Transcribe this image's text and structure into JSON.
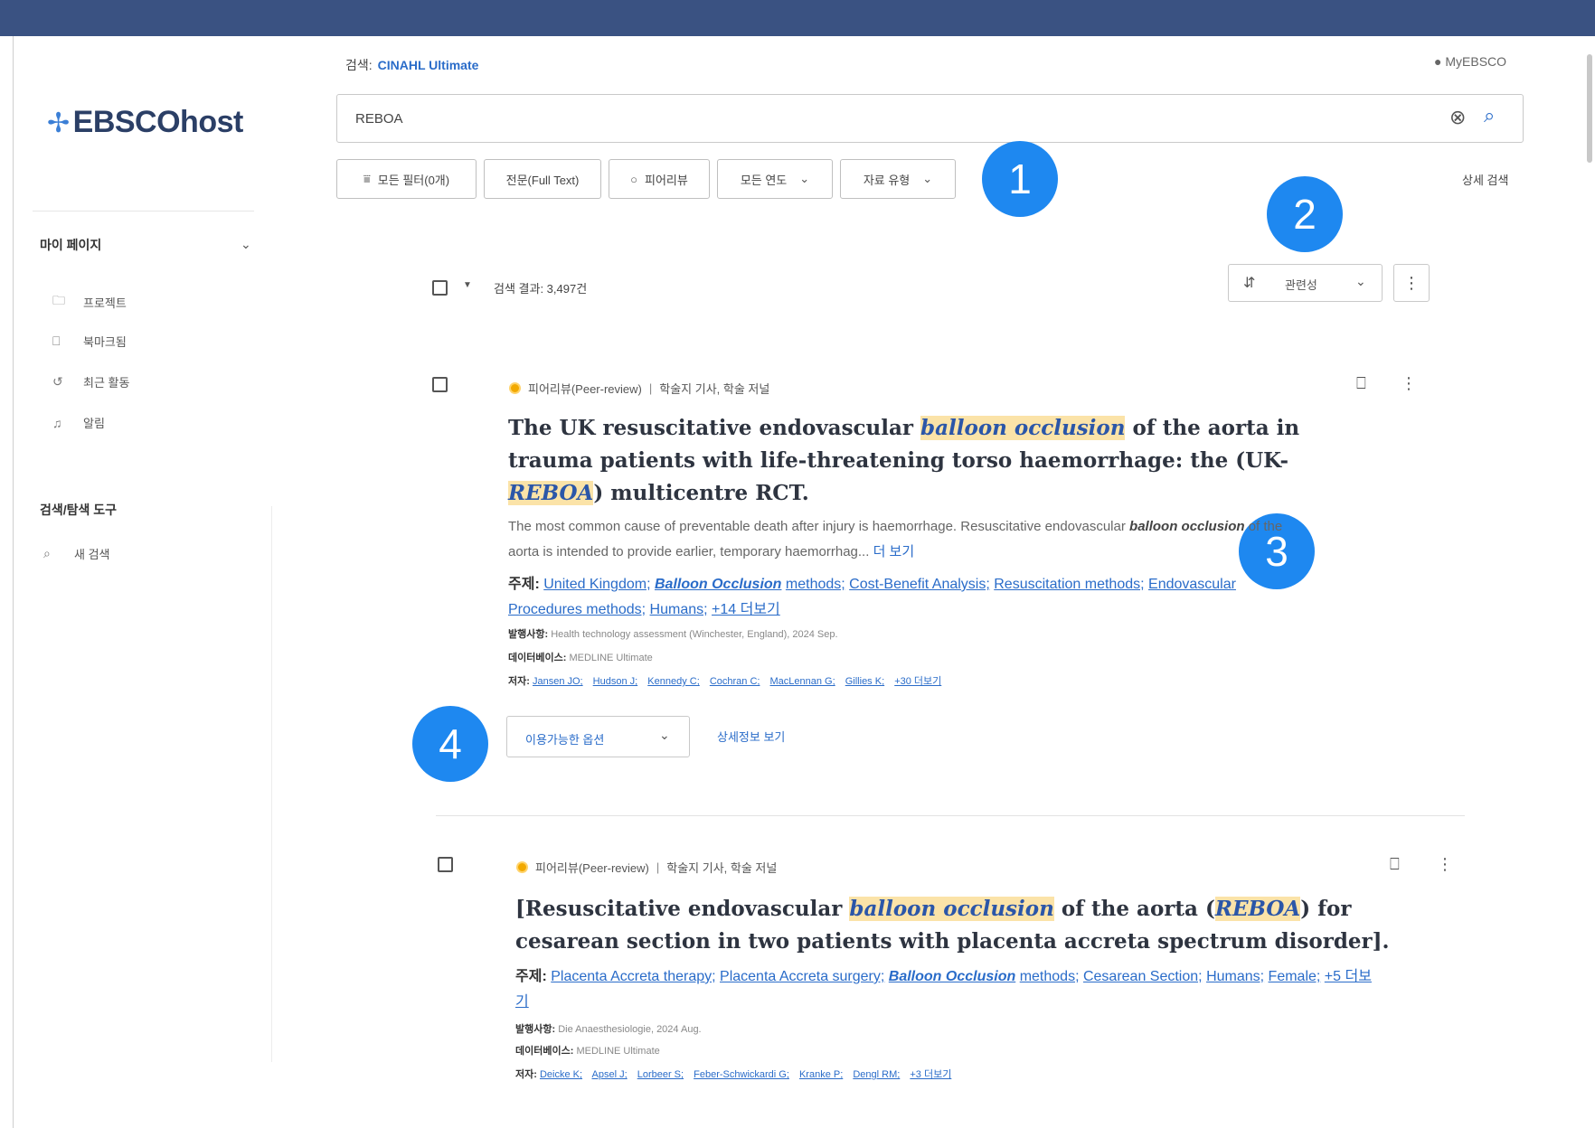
{
  "header": {
    "search_in_label": "검색:",
    "database": "CINAHL Ultimate",
    "account_label": "MyEBSCO"
  },
  "logo": {
    "text": "EBSCOhost"
  },
  "search": {
    "query": "REBOA"
  },
  "filters": {
    "all_filters": "모든 필터(0개)",
    "full_text": "전문(Full Text)",
    "peer_review": "피어리뷰",
    "all_years": "모든 연도",
    "source_type": "자료 유형",
    "advanced": "상세 검색"
  },
  "sidebar": {
    "my_page": "마이 페이지",
    "items": [
      {
        "icon": "folder-icon",
        "label": "프로젝트"
      },
      {
        "icon": "bookmark-icon",
        "label": "북마크됨"
      },
      {
        "icon": "history-icon",
        "label": "최근 활동"
      },
      {
        "icon": "bell-icon",
        "label": "알림"
      }
    ],
    "tools_heading": "검색/탐색 도구",
    "new_search": "새 검색"
  },
  "results_header": {
    "count": "검색 결과: 3,497건",
    "sort_value": "관련성"
  },
  "callouts": [
    "1",
    "2",
    "3",
    "4"
  ],
  "results": [
    {
      "peer": "피어리뷰(Peer-review)",
      "type": "학술지 기사, 학술 저널",
      "title_parts": [
        "The UK resuscitative endovascular ",
        "balloon occlusion",
        " of the aorta in trauma patients with life-threatening torso haemorrhage: the (UK-",
        "REBOA",
        ") multicentre RCT."
      ],
      "abstract_pre": "The most common cause of preventable death after injury is haemorrhage. Resuscitative endovascular",
      "abstract_hl": "balloon occlusion",
      "abstract_post": " of the aorta is intended to provide earlier, temporary haemorrhag...",
      "abstract_more": "더 보기",
      "subject_label": "주제:",
      "subjects": [
        "United Kingdom;",
        "Balloon Occlusion",
        "methods;",
        "Cost-Benefit Analysis;",
        "Resuscitation methods;",
        "Endovascular Procedures methods;",
        "Humans;",
        "+14 더보기"
      ],
      "pub_label": "발행사항:",
      "pub": "Health technology assessment (Winchester, England), 2024 Sep.",
      "db_label": "데이터베이스:",
      "db": "MEDLINE Ultimate",
      "auth_label": "저자:",
      "authors": [
        "Jansen JO;",
        "Hudson J;",
        "Kennedy C;",
        "Cochran C;",
        "MacLennan G;",
        "Gillies K;",
        "+30 더보기"
      ],
      "avail": "이용가능한 옵션",
      "details": "상세정보 보기"
    },
    {
      "peer": "피어리뷰(Peer-review)",
      "type": "학술지 기사, 학술 저널",
      "title_parts": [
        "[Resuscitative endovascular ",
        "balloon occlusion",
        " of the aorta (",
        "REBOA",
        ") for cesarean section in two patients with placenta accreta spectrum disorder]."
      ],
      "subject_label": "주제:",
      "subjects": [
        "Placenta Accreta therapy;",
        "Placenta Accreta surgery;",
        "Balloon Occlusion",
        "methods;",
        "Cesarean Section;",
        "Humans;",
        "Female;",
        "+5 더보기"
      ],
      "pub_label": "발행사항:",
      "pub": "Die Anaesthesiologie, 2024 Aug.",
      "db_label": "데이터베이스:",
      "db": "MEDLINE Ultimate",
      "auth_label": "저자:",
      "authors": [
        "Deicke K;",
        "Apsel J;",
        "Lorbeer S;",
        "Feber-Schwickardi G;",
        "Kranke P;",
        "Dengl RM;",
        "+3 더보기"
      ]
    }
  ],
  "colors": {
    "topbar": "#3a5282",
    "accent": "#2a6cc9",
    "callout": "#1e88f0",
    "highlight": "#fbe3a8",
    "peer_badge": "#f2a900"
  }
}
